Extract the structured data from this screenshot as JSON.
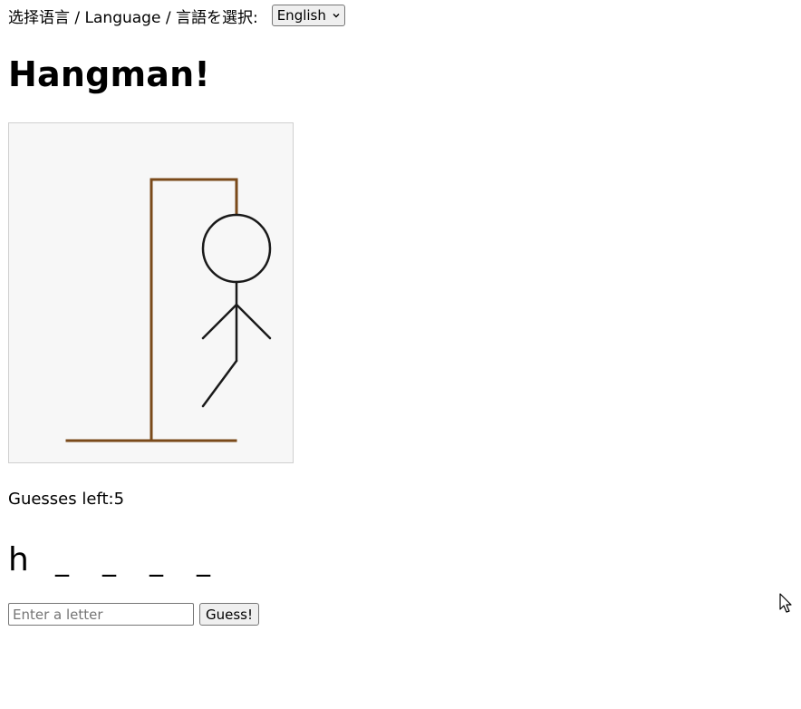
{
  "language_selector": {
    "label": "选择语言 / Language / 言語を選択:",
    "selected": "English",
    "icon": "chevron-down-icon"
  },
  "game": {
    "title": "Hangman!",
    "guesses_left_label": "Guesses left:",
    "guesses_left_value": "5",
    "word_slots": [
      "h",
      "_",
      "_",
      "_",
      "_"
    ]
  },
  "drawing": {
    "gallows_color": "#7a4a1a",
    "figure_color": "#1a1a1a",
    "canvas_background": "#f7f7f7",
    "visible_parts": [
      "base",
      "pole",
      "beam",
      "rope",
      "head",
      "body",
      "left-arm",
      "right-arm",
      "left-leg"
    ]
  },
  "guess_form": {
    "input_value": "",
    "input_placeholder": "Enter a letter",
    "button_label": "Guess!"
  }
}
